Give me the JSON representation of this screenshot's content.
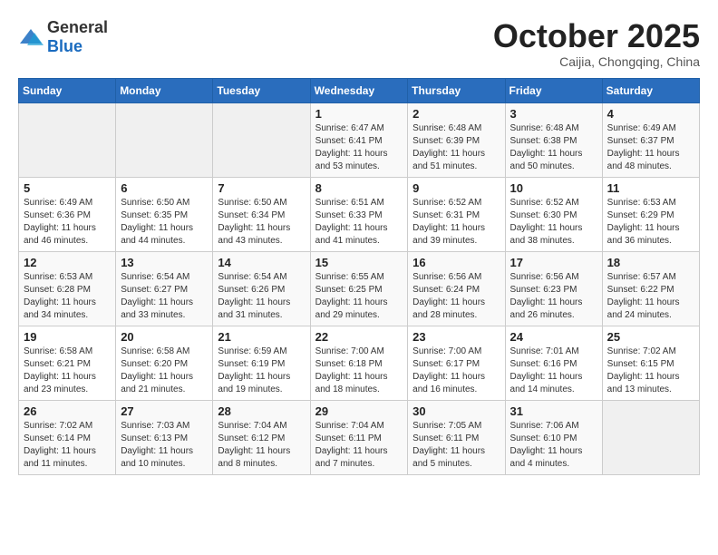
{
  "logo": {
    "text_general": "General",
    "text_blue": "Blue"
  },
  "header": {
    "month": "October 2025",
    "location": "Caijia, Chongqing, China"
  },
  "days_of_week": [
    "Sunday",
    "Monday",
    "Tuesday",
    "Wednesday",
    "Thursday",
    "Friday",
    "Saturday"
  ],
  "weeks": [
    [
      {
        "day": "",
        "info": ""
      },
      {
        "day": "",
        "info": ""
      },
      {
        "day": "",
        "info": ""
      },
      {
        "day": "1",
        "info": "Sunrise: 6:47 AM\nSunset: 6:41 PM\nDaylight: 11 hours\nand 53 minutes."
      },
      {
        "day": "2",
        "info": "Sunrise: 6:48 AM\nSunset: 6:39 PM\nDaylight: 11 hours\nand 51 minutes."
      },
      {
        "day": "3",
        "info": "Sunrise: 6:48 AM\nSunset: 6:38 PM\nDaylight: 11 hours\nand 50 minutes."
      },
      {
        "day": "4",
        "info": "Sunrise: 6:49 AM\nSunset: 6:37 PM\nDaylight: 11 hours\nand 48 minutes."
      }
    ],
    [
      {
        "day": "5",
        "info": "Sunrise: 6:49 AM\nSunset: 6:36 PM\nDaylight: 11 hours\nand 46 minutes."
      },
      {
        "day": "6",
        "info": "Sunrise: 6:50 AM\nSunset: 6:35 PM\nDaylight: 11 hours\nand 44 minutes."
      },
      {
        "day": "7",
        "info": "Sunrise: 6:50 AM\nSunset: 6:34 PM\nDaylight: 11 hours\nand 43 minutes."
      },
      {
        "day": "8",
        "info": "Sunrise: 6:51 AM\nSunset: 6:33 PM\nDaylight: 11 hours\nand 41 minutes."
      },
      {
        "day": "9",
        "info": "Sunrise: 6:52 AM\nSunset: 6:31 PM\nDaylight: 11 hours\nand 39 minutes."
      },
      {
        "day": "10",
        "info": "Sunrise: 6:52 AM\nSunset: 6:30 PM\nDaylight: 11 hours\nand 38 minutes."
      },
      {
        "day": "11",
        "info": "Sunrise: 6:53 AM\nSunset: 6:29 PM\nDaylight: 11 hours\nand 36 minutes."
      }
    ],
    [
      {
        "day": "12",
        "info": "Sunrise: 6:53 AM\nSunset: 6:28 PM\nDaylight: 11 hours\nand 34 minutes."
      },
      {
        "day": "13",
        "info": "Sunrise: 6:54 AM\nSunset: 6:27 PM\nDaylight: 11 hours\nand 33 minutes."
      },
      {
        "day": "14",
        "info": "Sunrise: 6:54 AM\nSunset: 6:26 PM\nDaylight: 11 hours\nand 31 minutes."
      },
      {
        "day": "15",
        "info": "Sunrise: 6:55 AM\nSunset: 6:25 PM\nDaylight: 11 hours\nand 29 minutes."
      },
      {
        "day": "16",
        "info": "Sunrise: 6:56 AM\nSunset: 6:24 PM\nDaylight: 11 hours\nand 28 minutes."
      },
      {
        "day": "17",
        "info": "Sunrise: 6:56 AM\nSunset: 6:23 PM\nDaylight: 11 hours\nand 26 minutes."
      },
      {
        "day": "18",
        "info": "Sunrise: 6:57 AM\nSunset: 6:22 PM\nDaylight: 11 hours\nand 24 minutes."
      }
    ],
    [
      {
        "day": "19",
        "info": "Sunrise: 6:58 AM\nSunset: 6:21 PM\nDaylight: 11 hours\nand 23 minutes."
      },
      {
        "day": "20",
        "info": "Sunrise: 6:58 AM\nSunset: 6:20 PM\nDaylight: 11 hours\nand 21 minutes."
      },
      {
        "day": "21",
        "info": "Sunrise: 6:59 AM\nSunset: 6:19 PM\nDaylight: 11 hours\nand 19 minutes."
      },
      {
        "day": "22",
        "info": "Sunrise: 7:00 AM\nSunset: 6:18 PM\nDaylight: 11 hours\nand 18 minutes."
      },
      {
        "day": "23",
        "info": "Sunrise: 7:00 AM\nSunset: 6:17 PM\nDaylight: 11 hours\nand 16 minutes."
      },
      {
        "day": "24",
        "info": "Sunrise: 7:01 AM\nSunset: 6:16 PM\nDaylight: 11 hours\nand 14 minutes."
      },
      {
        "day": "25",
        "info": "Sunrise: 7:02 AM\nSunset: 6:15 PM\nDaylight: 11 hours\nand 13 minutes."
      }
    ],
    [
      {
        "day": "26",
        "info": "Sunrise: 7:02 AM\nSunset: 6:14 PM\nDaylight: 11 hours\nand 11 minutes."
      },
      {
        "day": "27",
        "info": "Sunrise: 7:03 AM\nSunset: 6:13 PM\nDaylight: 11 hours\nand 10 minutes."
      },
      {
        "day": "28",
        "info": "Sunrise: 7:04 AM\nSunset: 6:12 PM\nDaylight: 11 hours\nand 8 minutes."
      },
      {
        "day": "29",
        "info": "Sunrise: 7:04 AM\nSunset: 6:11 PM\nDaylight: 11 hours\nand 7 minutes."
      },
      {
        "day": "30",
        "info": "Sunrise: 7:05 AM\nSunset: 6:11 PM\nDaylight: 11 hours\nand 5 minutes."
      },
      {
        "day": "31",
        "info": "Sunrise: 7:06 AM\nSunset: 6:10 PM\nDaylight: 11 hours\nand 4 minutes."
      },
      {
        "day": "",
        "info": ""
      }
    ]
  ]
}
